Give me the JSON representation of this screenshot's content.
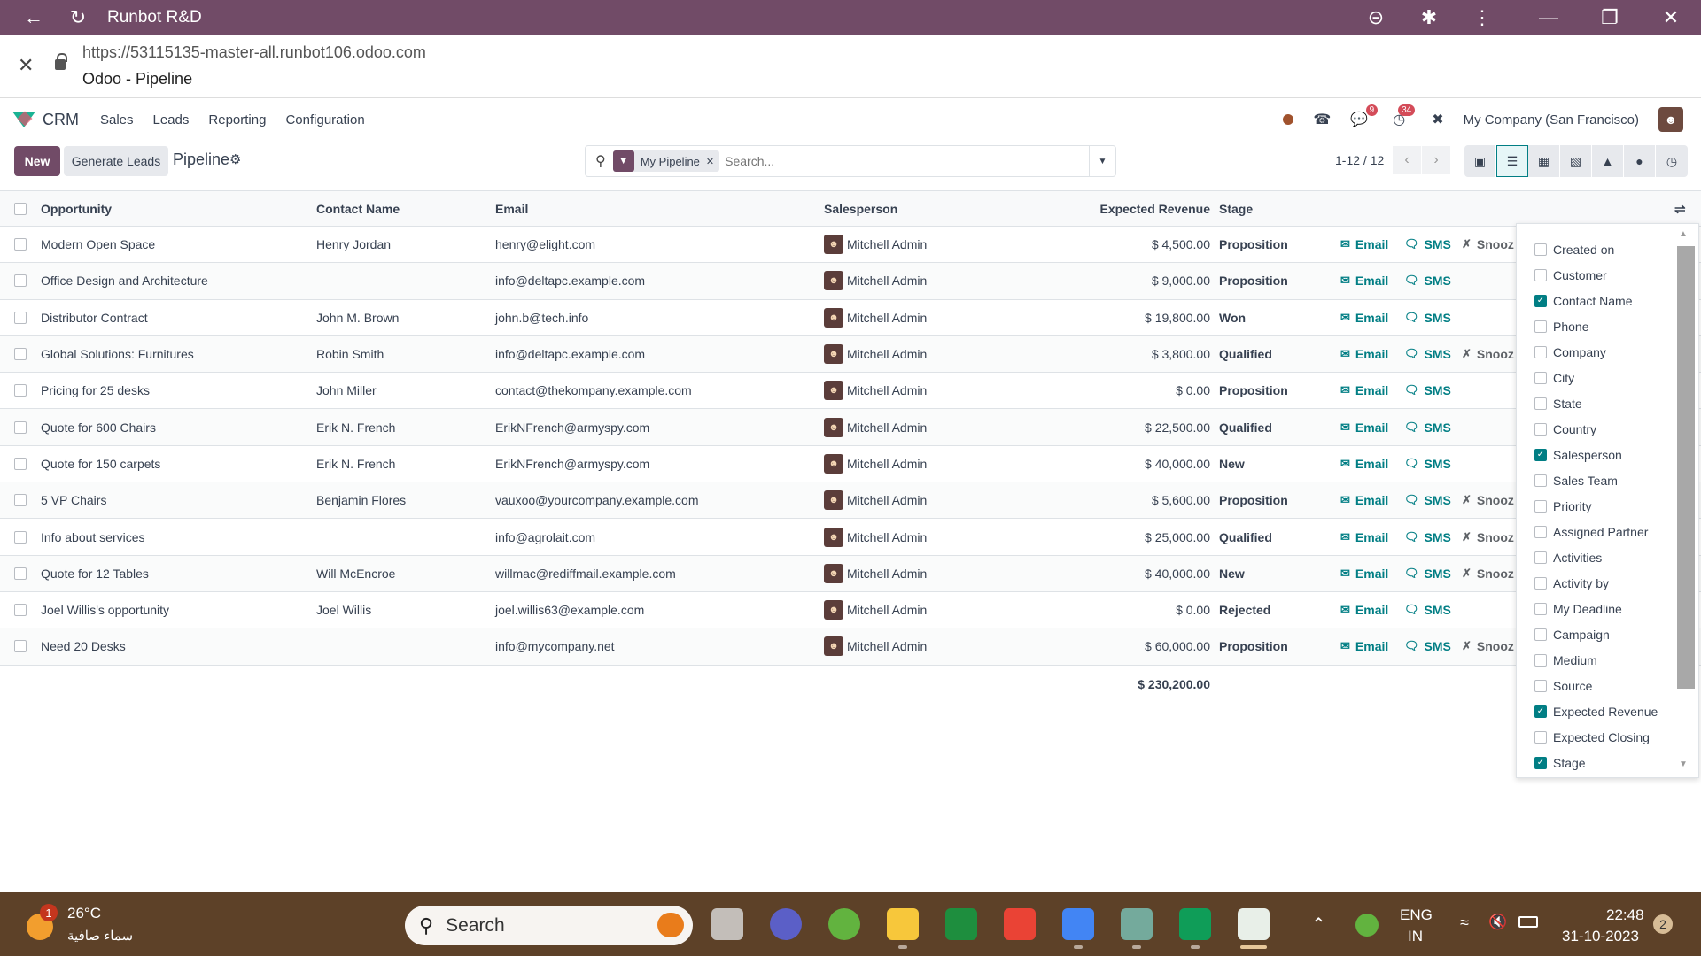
{
  "browser": {
    "title": "Runbot R&D",
    "url": "https://53115135-master-all.runbot106.odoo.com",
    "page_title": "Odoo - Pipeline"
  },
  "navbar": {
    "app": "CRM",
    "menus": [
      "Sales",
      "Leads",
      "Reporting",
      "Configuration"
    ],
    "messages_badge": "9",
    "activities_badge": "34",
    "company": "My Company (San Francisco)"
  },
  "control_panel": {
    "new_label": "New",
    "generate_label": "Generate Leads",
    "breadcrumb": "Pipeline",
    "facet_label": "My Pipeline",
    "search_placeholder": "Search...",
    "pager": "1-12 / 12"
  },
  "table": {
    "headers": {
      "opportunity": "Opportunity",
      "contact": "Contact Name",
      "email": "Email",
      "salesperson": "Salesperson",
      "revenue": "Expected Revenue",
      "stage": "Stage"
    },
    "action_email": "Email",
    "action_sms": "SMS",
    "action_snooze": "Snooz",
    "rows": [
      {
        "opportunity": "Modern Open Space",
        "contact": "Henry Jordan",
        "email": "henry@elight.com",
        "salesperson": "Mitchell Admin",
        "revenue": "$ 4,500.00",
        "stage": "Proposition",
        "snooze": true
      },
      {
        "opportunity": "Office Design and Architecture",
        "contact": "",
        "email": "info@deltapc.example.com",
        "salesperson": "Mitchell Admin",
        "revenue": "$ 9,000.00",
        "stage": "Proposition",
        "snooze": false
      },
      {
        "opportunity": "Distributor Contract",
        "contact": "John M. Brown",
        "email": "john.b@tech.info",
        "salesperson": "Mitchell Admin",
        "revenue": "$ 19,800.00",
        "stage": "Won",
        "snooze": false
      },
      {
        "opportunity": "Global Solutions: Furnitures",
        "contact": "Robin Smith",
        "email": "info@deltapc.example.com",
        "salesperson": "Mitchell Admin",
        "revenue": "$ 3,800.00",
        "stage": "Qualified",
        "snooze": true
      },
      {
        "opportunity": "Pricing for 25 desks",
        "contact": "John Miller",
        "email": "contact@thekompany.example.com",
        "salesperson": "Mitchell Admin",
        "revenue": "$ 0.00",
        "stage": "Proposition",
        "snooze": false
      },
      {
        "opportunity": "Quote for 600 Chairs",
        "contact": "Erik N. French",
        "email": "ErikNFrench@armyspy.com",
        "salesperson": "Mitchell Admin",
        "revenue": "$ 22,500.00",
        "stage": "Qualified",
        "snooze": false
      },
      {
        "opportunity": "Quote for 150 carpets",
        "contact": "Erik N. French",
        "email": "ErikNFrench@armyspy.com",
        "salesperson": "Mitchell Admin",
        "revenue": "$ 40,000.00",
        "stage": "New",
        "snooze": false
      },
      {
        "opportunity": "5 VP Chairs",
        "contact": "Benjamin Flores",
        "email": "vauxoo@yourcompany.example.com",
        "salesperson": "Mitchell Admin",
        "revenue": "$ 5,600.00",
        "stage": "Proposition",
        "snooze": true
      },
      {
        "opportunity": "Info about services",
        "contact": "",
        "email": "info@agrolait.com",
        "salesperson": "Mitchell Admin",
        "revenue": "$ 25,000.00",
        "stage": "Qualified",
        "snooze": true
      },
      {
        "opportunity": "Quote for 12 Tables",
        "contact": "Will McEncroe",
        "email": "willmac@rediffmail.example.com",
        "salesperson": "Mitchell Admin",
        "revenue": "$ 40,000.00",
        "stage": "New",
        "snooze": true
      },
      {
        "opportunity": "Joel Willis's opportunity",
        "contact": "Joel Willis",
        "email": "joel.willis63@example.com",
        "salesperson": "Mitchell Admin",
        "revenue": "$ 0.00",
        "stage": "Rejected",
        "snooze": false
      },
      {
        "opportunity": "Need 20 Desks",
        "contact": "",
        "email": "info@mycompany.net",
        "salesperson": "Mitchell Admin",
        "revenue": "$ 60,000.00",
        "stage": "Proposition",
        "snooze": true
      }
    ],
    "total_revenue": "$ 230,200.00"
  },
  "optional_columns": [
    {
      "label": "Created on",
      "checked": false
    },
    {
      "label": "Customer",
      "checked": false
    },
    {
      "label": "Contact Name",
      "checked": true
    },
    {
      "label": "Phone",
      "checked": false
    },
    {
      "label": "Company",
      "checked": false
    },
    {
      "label": "City",
      "checked": false
    },
    {
      "label": "State",
      "checked": false
    },
    {
      "label": "Country",
      "checked": false
    },
    {
      "label": "Salesperson",
      "checked": true
    },
    {
      "label": "Sales Team",
      "checked": false
    },
    {
      "label": "Priority",
      "checked": false
    },
    {
      "label": "Assigned Partner",
      "checked": false
    },
    {
      "label": "Activities",
      "checked": false
    },
    {
      "label": "Activity by",
      "checked": false
    },
    {
      "label": "My Deadline",
      "checked": false
    },
    {
      "label": "Campaign",
      "checked": false
    },
    {
      "label": "Medium",
      "checked": false
    },
    {
      "label": "Source",
      "checked": false
    },
    {
      "label": "Expected Revenue",
      "checked": true
    },
    {
      "label": "Expected Closing",
      "checked": false
    },
    {
      "label": "Stage",
      "checked": true
    }
  ],
  "taskbar": {
    "weather_temp": "26°C",
    "weather_desc": "سماء صافية",
    "weather_badge": "1",
    "search_label": "Search",
    "lang_1": "ENG",
    "lang_2": "IN",
    "time": "22:48",
    "date": "31-10-2023",
    "notif_count": "2"
  },
  "colors": {
    "brand": "#714b67",
    "accent": "#017e84",
    "badge": "#d44c59"
  }
}
